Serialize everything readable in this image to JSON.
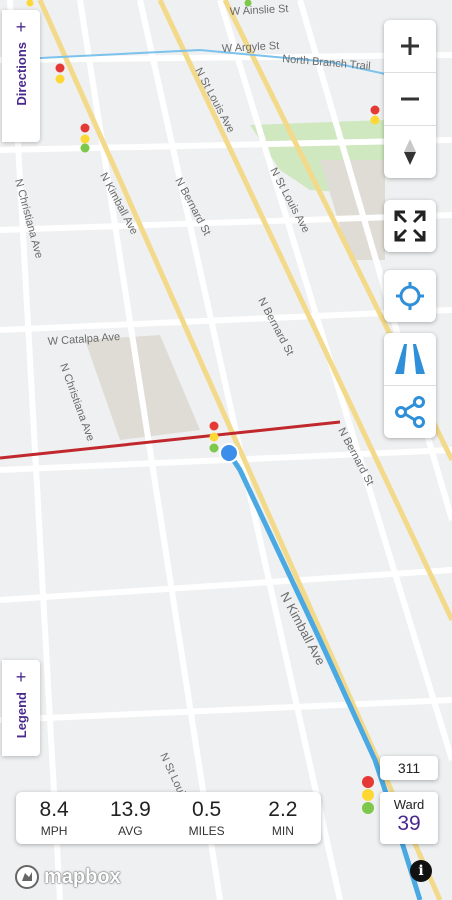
{
  "map": {
    "streets": [
      "N Kimball Ave",
      "N Bernard St",
      "N St Louis Ave",
      "N Christiana Ave",
      "W Catalpa Ave",
      "W Argyle St",
      "W Ainslie St",
      "North Branch Trail"
    ],
    "colors": {
      "route": "#4aa8e3",
      "current_location": "#3b8eea",
      "red_line": "#c0282d",
      "park": "#cfe8c0",
      "arterial": "#f3d98a"
    }
  },
  "side_tabs": {
    "directions": "Directions",
    "legend": "Legend"
  },
  "controls": [
    "plus-icon",
    "minus-icon",
    "compass-icon",
    "fullscreen-icon",
    "locate-icon",
    "lanes-icon",
    "share-icon"
  ],
  "stats": [
    {
      "value": "8.4",
      "unit": "MPH"
    },
    {
      "value": "13.9",
      "unit": "AVG"
    },
    {
      "value": "0.5",
      "unit": "MILES"
    },
    {
      "value": "2.2",
      "unit": "MIN"
    }
  ],
  "badges": {
    "three11": "311",
    "ward_label": "Ward",
    "ward_number": "39"
  },
  "attribution": {
    "logo": "mapbox",
    "info": "i"
  }
}
